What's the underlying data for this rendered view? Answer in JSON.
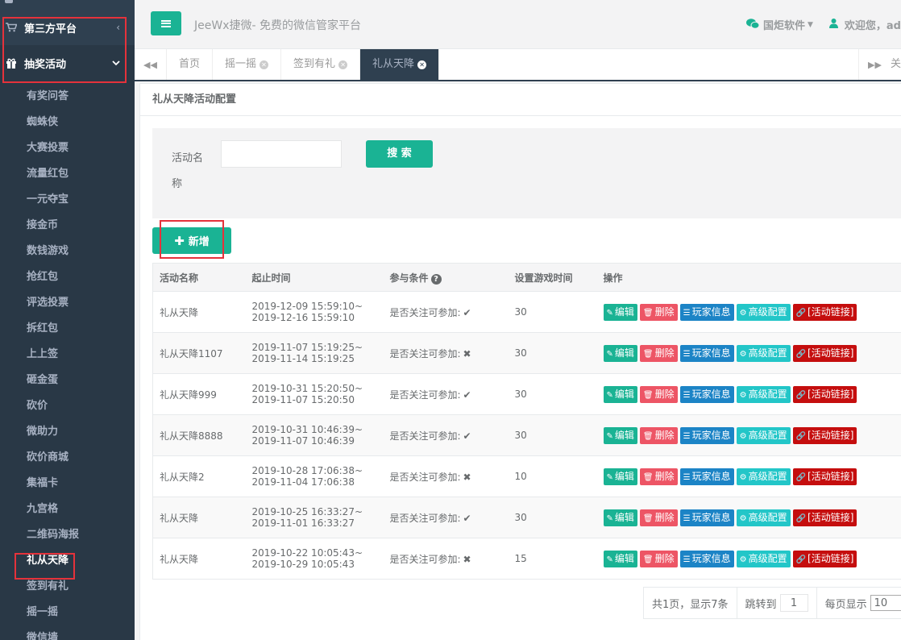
{
  "sidebar": {
    "parents": [
      {
        "label": "第三方平台",
        "icon": "cart-icon",
        "arrow": "‹"
      },
      {
        "label": "抽奖活动",
        "icon": "gift-icon",
        "arrow": "⌄"
      }
    ],
    "items": [
      {
        "label": "有奖问答"
      },
      {
        "label": "蜘蛛侠"
      },
      {
        "label": "大赛投票"
      },
      {
        "label": "流量红包"
      },
      {
        "label": "一元夺宝"
      },
      {
        "label": "接金币"
      },
      {
        "label": "数钱游戏"
      },
      {
        "label": "抢红包"
      },
      {
        "label": "评选投票"
      },
      {
        "label": "拆红包"
      },
      {
        "label": "上上签"
      },
      {
        "label": "砸金蛋"
      },
      {
        "label": "砍价"
      },
      {
        "label": "微助力"
      },
      {
        "label": "砍价商城"
      },
      {
        "label": "集福卡"
      },
      {
        "label": "九宫格"
      },
      {
        "label": "二维码海报"
      },
      {
        "label": "礼从天降"
      },
      {
        "label": "签到有礼"
      },
      {
        "label": "摇一摇"
      },
      {
        "label": "微信墙"
      }
    ]
  },
  "header": {
    "brand": "JeeWx捷微- 免费的微信管家平台",
    "vendor": "国炬软件",
    "welcome": "欢迎您，ad"
  },
  "tabs": [
    {
      "label": "首页",
      "closable": false
    },
    {
      "label": "摇一摇",
      "closable": true
    },
    {
      "label": "签到有礼",
      "closable": true
    },
    {
      "label": "礼从天降",
      "closable": true,
      "active": true
    }
  ],
  "tabs_more": "关",
  "panel": {
    "title": "礼从天降活动配置",
    "search_label": "活动名称",
    "search_value": "",
    "search_button": "搜 索",
    "add_button": "新增"
  },
  "table": {
    "headers": [
      "活动名称",
      "起止时间",
      "参与条件",
      "设置游戏时间",
      "操作"
    ],
    "condition_text": "是否关注可参加:",
    "actions": {
      "edit": "编辑",
      "delete": "删除",
      "players": "玩家信息",
      "advanced": "高级配置",
      "link": "[活动链接]"
    },
    "rows": [
      {
        "name": "礼从天降",
        "start": "2019-12-09 15:59:10~",
        "end": "2019-12-16 15:59:10",
        "follow": "✔",
        "time": "30"
      },
      {
        "name": "礼从天降1107",
        "start": "2019-11-07 15:19:25~",
        "end": "2019-11-14 15:19:25",
        "follow": "✖",
        "time": "30"
      },
      {
        "name": "礼从天降999",
        "start": "2019-10-31 15:20:50~",
        "end": "2019-11-07 15:20:50",
        "follow": "✔",
        "time": "30"
      },
      {
        "name": "礼从天降8888",
        "start": "2019-10-31 10:46:39~",
        "end": "2019-11-07 10:46:39",
        "follow": "✔",
        "time": "30"
      },
      {
        "name": "礼从天降2",
        "start": "2019-10-28 17:06:38~",
        "end": "2019-11-04 17:06:38",
        "follow": "✖",
        "time": "10"
      },
      {
        "name": "礼从天降",
        "start": "2019-10-25 16:33:27~",
        "end": "2019-11-01 16:33:27",
        "follow": "✔",
        "time": "30"
      },
      {
        "name": "礼从天降",
        "start": "2019-10-22 10:05:43~",
        "end": "2019-10-29 10:05:43",
        "follow": "✖",
        "time": "15"
      }
    ]
  },
  "pager": {
    "summary": "共1页，显示7条",
    "jump_label": "跳转到",
    "jump_value": "1",
    "page_size_label": "每页显示",
    "page_size": "10"
  },
  "colors": {
    "sidebar": "#2f4050",
    "primary": "#1ab394",
    "danger": "#ed5565",
    "info": "#1c84c6",
    "teal": "#23c6c8",
    "link": "#c50e0e",
    "highlight": "#e5323b"
  }
}
